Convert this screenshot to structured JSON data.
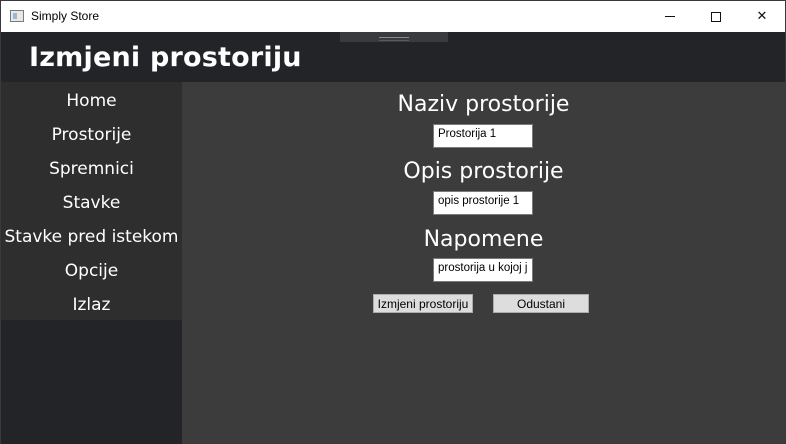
{
  "window": {
    "title": "Simply Store",
    "controls": {
      "minimize": "minimize",
      "maximize": "maximize",
      "close": "✕"
    }
  },
  "header": {
    "title": "Izmjeni prostoriju"
  },
  "sidebar": {
    "items": [
      {
        "label": "Home"
      },
      {
        "label": "Prostorije"
      },
      {
        "label": "Spremnici"
      },
      {
        "label": "Stavke"
      },
      {
        "label": "Stavke pred istekom"
      },
      {
        "label": "Opcije"
      },
      {
        "label": "Izlaz"
      }
    ]
  },
  "form": {
    "name": {
      "label": "Naziv prostorije",
      "value": "Prostorija 1"
    },
    "description": {
      "label": "Opis prostorije",
      "value": "opis prostorije 1"
    },
    "notes": {
      "label": "Napomene",
      "value": "prostorija u kojoj j"
    },
    "save_label": "Izmjeni prostoriju",
    "cancel_label": "Odustani"
  },
  "colors": {
    "header_bg": "#232427",
    "sidebar_bg": "#2e2e2e",
    "content_bg": "#3c3c3c",
    "text": "#ffffff"
  }
}
